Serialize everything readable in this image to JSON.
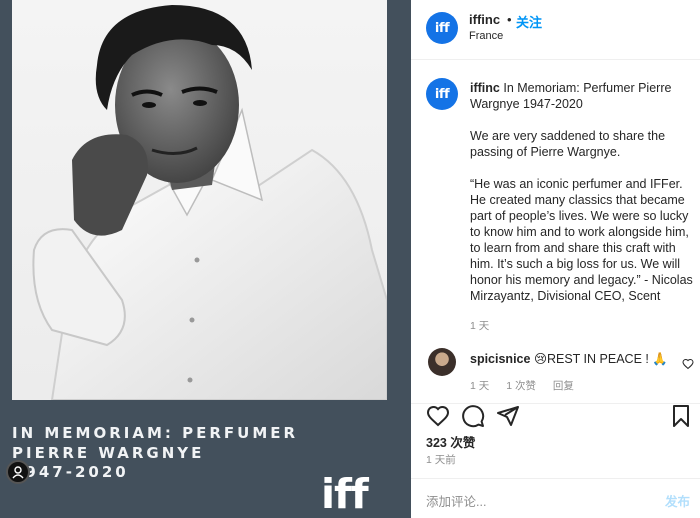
{
  "header": {
    "avatar_text": "iff",
    "username": "iffinc",
    "dot": "•",
    "follow_label": "关注",
    "location": "France"
  },
  "post": {
    "avatar_text": "iff",
    "username": "iffinc",
    "title": "In Memoriam: Perfumer Pierre Wargnye 1947-2020",
    "para1": "We are very saddened to share the passing of Pierre Wargnye.",
    "para2": "“He was an iconic perfumer and IFFer. He created many classics that became part of people’s lives. We were so lucky to know him and to work alongside him, to learn from and share this craft with him. It’s such a big loss for us. We will honor his memory and legacy.” - Nicolas Mirzayantz, Divisional CEO, Scent",
    "time": "1 天"
  },
  "comment": {
    "username": "spicisnice",
    "text": "😢REST IN PEACE ! 🙏",
    "time": "1 天",
    "likes": "1 次赞",
    "reply": "回复"
  },
  "actions": {
    "likes_count": "323 次赞",
    "posted_ago": "1 天前"
  },
  "add_comment": {
    "placeholder": "添加评论...",
    "post_label": "发布"
  },
  "media": {
    "caption_lines": [
      "IN MEMORIAM: PERFUMER",
      "PIERRE WARGNYE",
      "1947-2020"
    ],
    "logo_text": "iff"
  },
  "colors": {
    "accent": "#0095f6",
    "brand": "#1473e6",
    "media_bg": "#43505c"
  }
}
